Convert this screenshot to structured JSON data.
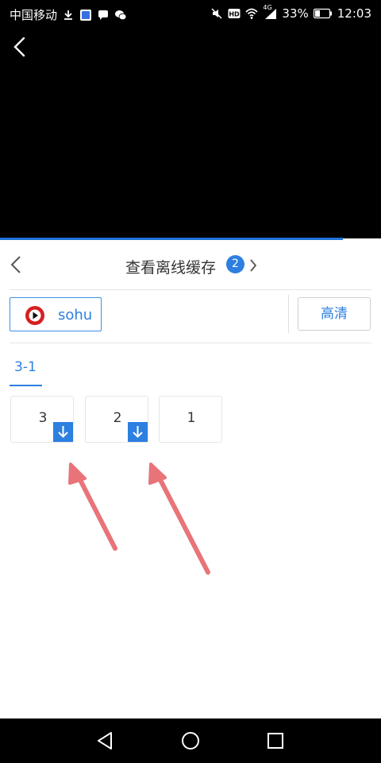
{
  "status_bar": {
    "carrier": "中国移动",
    "battery": "33%",
    "time": "12:03",
    "hd_label": "HD",
    "network": "4G",
    "icons": [
      "download-icon",
      "app-icon",
      "chat-icon",
      "wechat-icon",
      "mute-icon",
      "hd-icon",
      "wifi-icon",
      "signal-icon",
      "battery-icon"
    ]
  },
  "video": {
    "back_icon": "back-arrow-icon"
  },
  "panel": {
    "title": "查看离线缓存",
    "badge_count": "2",
    "source": {
      "label": "sohu",
      "logo": "sohu-logo-icon"
    },
    "quality_label": "高清",
    "episode_tab": "3-1",
    "episodes": [
      {
        "number": "3",
        "downloaded": true
      },
      {
        "number": "2",
        "downloaded": true
      },
      {
        "number": "1",
        "downloaded": false
      }
    ]
  },
  "nav": {
    "icons": [
      "nav-back-icon",
      "nav-home-icon",
      "nav-recents-icon"
    ]
  },
  "colors": {
    "accent": "#2d7fe0",
    "annotation_arrow": "#e8747a",
    "video_bg": "#000000"
  }
}
